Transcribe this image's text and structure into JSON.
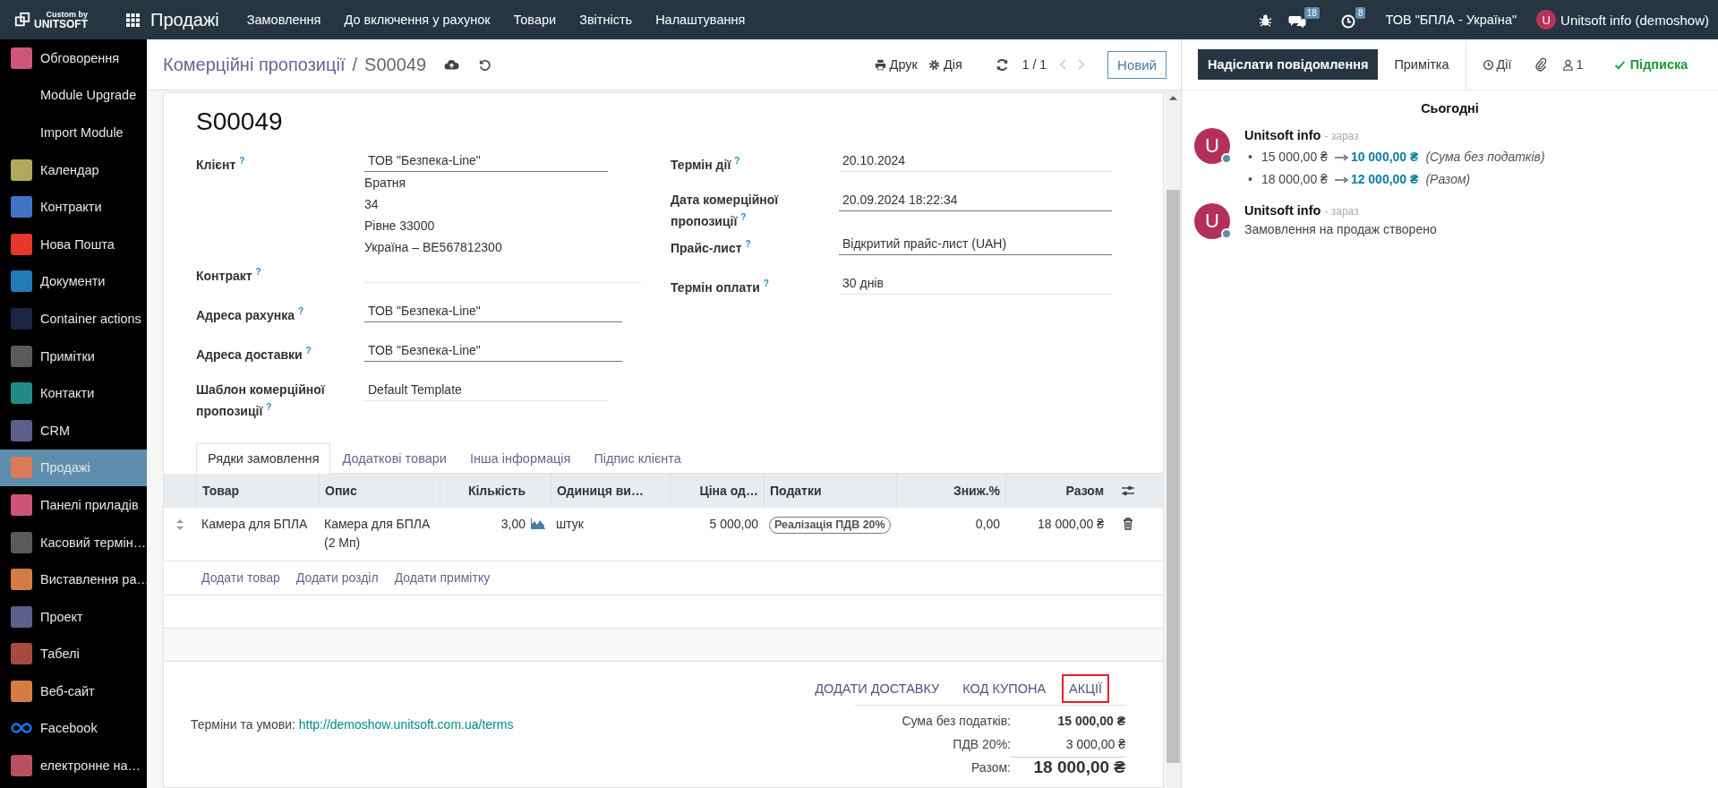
{
  "top_bar": {
    "logo_caption": "Custom by",
    "logo_name": "UNITSOFT",
    "app_name": "Продажі",
    "menu": [
      "Замовлення",
      "До включення у рахунок",
      "Товари",
      "Звітність",
      "Налаштування"
    ],
    "chat_count": "18",
    "activity_count": "8",
    "company": "ТОВ \"БПЛА - Україна\"",
    "user_initial": "U",
    "user_name": "Unitsoft info (demoshow)"
  },
  "sidebar": {
    "items": [
      {
        "label": "Обговорення",
        "kind": "tile",
        "color": "#d0557a",
        "selected": false
      },
      {
        "label": "Module Upgrade",
        "kind": "none",
        "selected": false
      },
      {
        "label": "Import Module",
        "kind": "none",
        "selected": false
      },
      {
        "label": "Календар",
        "kind": "tile",
        "color": "#b3a95c",
        "selected": false
      },
      {
        "label": "Контракти",
        "kind": "tile",
        "color": "#4272c4",
        "selected": false
      },
      {
        "label": "Нова Пошта",
        "kind": "tile",
        "color": "#e5372b",
        "selected": false
      },
      {
        "label": "Документи",
        "kind": "tile",
        "color": "#1f7ab5",
        "selected": false
      },
      {
        "label": "Container actions",
        "kind": "tile",
        "color": "#1c2442",
        "selected": false
      },
      {
        "label": "Примітки",
        "kind": "tile",
        "color": "#5a5a5a",
        "selected": false
      },
      {
        "label": "Контакти",
        "kind": "tile",
        "color": "#218a85",
        "selected": false
      },
      {
        "label": "CRM",
        "kind": "tile",
        "color": "#5c5f8c",
        "selected": false
      },
      {
        "label": "Продажі",
        "kind": "tile",
        "color": "#d97a58",
        "selected": true
      },
      {
        "label": "Панелі приладів",
        "kind": "tile",
        "color": "#cc5577",
        "selected": false
      },
      {
        "label": "Касовий термін…",
        "kind": "tile",
        "color": "#5a5a5a",
        "selected": false
      },
      {
        "label": "Виставлення ра…",
        "kind": "tile",
        "color": "#d47c45",
        "selected": false
      },
      {
        "label": "Проект",
        "kind": "tile",
        "color": "#5c5f8c",
        "selected": false
      },
      {
        "label": "Табелі",
        "kind": "tile",
        "color": "#a64b3e",
        "selected": false
      },
      {
        "label": "Веб-сайт",
        "kind": "tile",
        "color": "#d47c45",
        "selected": false
      },
      {
        "label": "Facebook",
        "kind": "glyph",
        "color": "#1877f2",
        "selected": false
      },
      {
        "label": "електронне на…",
        "kind": "tile",
        "color": "#b8505e",
        "selected": false
      }
    ]
  },
  "control_panel": {
    "breadcrumb_parent": "Комерційні пропозиції",
    "separator": "/",
    "record": "S00049",
    "print": "Друк",
    "action": "Дія",
    "pager": "1 / 1",
    "new_button": "Новий"
  },
  "form": {
    "title": "S00049",
    "left_fields": [
      {
        "label": "Клієнт",
        "help": "?",
        "value": "ТОВ \"Безпека-Line\"",
        "kind": "input",
        "address": [
          "Братня",
          "34",
          "Рівне 33000",
          "Україна – BE567812300"
        ]
      },
      {
        "label": "Контракт",
        "help": "?",
        "kind": "empty"
      },
      {
        "label": "Адреса рахунка",
        "help": "?",
        "value": "ТОВ \"Безпека-Line\"",
        "kind": "input"
      },
      {
        "label": "Адреса доставки",
        "help": "?",
        "value": "ТОВ \"Безпека-Line\"",
        "kind": "input"
      },
      {
        "label": "Шаблон комерційної пропозиції",
        "help": "?",
        "value": "Default Template",
        "kind": "plain"
      }
    ],
    "right_fields": [
      {
        "label": "Термін дії",
        "help": "?",
        "value": "20.10.2024",
        "kind": "plain"
      },
      {
        "label": "Дата комерційної пропозиції",
        "help": "?",
        "value": "20.09.2024 18:22:34",
        "kind": "input"
      },
      {
        "label": "Прайс-лист",
        "help": "?",
        "value": "Відкритий прайс-лист (UAH)",
        "kind": "input"
      },
      {
        "label": "Термін оплати",
        "help": "?",
        "value": "30 днів",
        "kind": "plain"
      }
    ]
  },
  "notebook": {
    "tabs": [
      {
        "label": "Рядки замовлення",
        "selected": true
      },
      {
        "label": "Додаткові товари",
        "selected": false
      },
      {
        "label": "Інша інформація",
        "selected": false
      },
      {
        "label": "Підпис клієнта",
        "selected": false
      }
    ]
  },
  "order_lines": {
    "columns": [
      "Товар",
      "Опис",
      "Кількість",
      "Одиниця ви…",
      "Ціна од…",
      "Податки",
      "Зниж.%",
      "Разом"
    ],
    "rows": [
      {
        "product": "Камера для БПЛА",
        "description": "Камера для БПЛА (2 Мп)",
        "quantity": "3,00",
        "uom": "штук",
        "price": "5 000,00",
        "tax": "Реалізація ПДВ 20%",
        "discount": "0,00",
        "subtotal": "18 000,00 ₴"
      }
    ],
    "add_links": [
      "Додати товар",
      "Додати розділ",
      "Додати примітку"
    ]
  },
  "footer": {
    "buttons": [
      {
        "label": "ДОДАТИ ДОСТАВКУ",
        "highlighted": false
      },
      {
        "label": "КОД КУПОНА",
        "highlighted": false
      },
      {
        "label": "АКЦІЇ",
        "highlighted": true
      }
    ],
    "terms_label": "Терміни та умови:",
    "terms_link": "http://demoshow.unitsoft.com.ua/terms",
    "totals": [
      {
        "label": "Сума без податків:",
        "value": "15 000,00 ₴",
        "kind": "bold"
      },
      {
        "label": "ПДВ 20%:",
        "value": "3 000,00 ₴",
        "kind": "normal"
      },
      {
        "label": "Разом:",
        "value": "18 000,00 ₴",
        "kind": "grand"
      }
    ]
  },
  "chatter": {
    "send_message": "Надіслати повідомлення",
    "note": "Примітка",
    "activities": "Дії",
    "followers": "1",
    "follow": "Підписка",
    "date_separator": "Сьогодні",
    "messages": [
      {
        "author": "Unitsoft info",
        "time": "- зараз",
        "avatar": "U",
        "kind": "tracking",
        "changes": [
          {
            "marker": "•",
            "old": "15 000,00 ₴",
            "new": "10 000,00 ₴",
            "field": "(Сума без податків)"
          },
          {
            "marker": "•",
            "old": "18 000,00 ₴",
            "new": "12 000,00 ₴",
            "field": "(Разом)"
          }
        ]
      },
      {
        "author": "Unitsoft info",
        "time": "- зараз",
        "avatar": "U",
        "kind": "text",
        "body": "Замовлення на продаж створено"
      }
    ]
  }
}
